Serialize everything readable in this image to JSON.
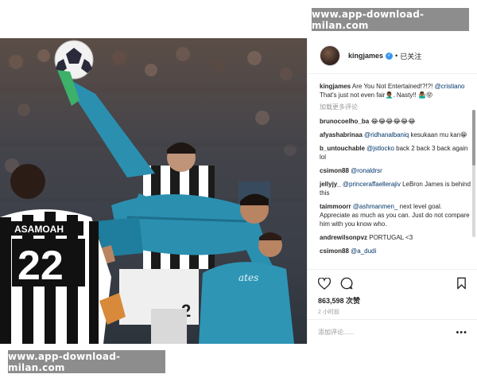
{
  "watermark": {
    "text": "www.app-download-milan.com"
  },
  "post": {
    "username": "kingjames",
    "follow_status": "已关注",
    "separator": "•",
    "verified_icon": "✓"
  },
  "comments": [
    {
      "user": "kingjames",
      "text": "Are You Not Entertained!?!?! ",
      "mention": "@cristiano",
      "text2": " That's just not even fair🤦🏾‍♂️. Nasty!! 🤷🏾‍♂️😝"
    },
    {
      "load_more": "加载更多评论"
    },
    {
      "user": "brunocoelho_ba",
      "text": "😂😂😂😂😂😂"
    },
    {
      "user": "afyashabrinaa",
      "mention": "@ridhanalbaniq",
      "text2": " kesukaan mu kan😁"
    },
    {
      "user": "b_untouchable",
      "mention": "@jstlocko",
      "text2": " back 2 back 3 back again lol"
    },
    {
      "user": "csimon88",
      "mention": "@ronaldrsr"
    },
    {
      "user": "jellyjy_",
      "mention": "@princeraffaellerajiv",
      "text2": " LeBron James is behind this"
    },
    {
      "user": "taimmoorr",
      "mention": "@ashmanmen_",
      "text2": " next level goal. Appreciate as much as you can. Just do not compare him with you know who."
    },
    {
      "user": "andrewilsonpvz",
      "text": "PORTUGAL <3"
    },
    {
      "user": "csimon88",
      "mention": "@a_dudi"
    }
  ],
  "actions": {
    "likes": "863,598 次赞",
    "time": "2 小时前",
    "comment_placeholder": "添加评论......",
    "more": "•••"
  },
  "icons": {
    "like": "heart-icon",
    "comment": "comment-icon",
    "save": "bookmark-icon",
    "more": "more-options-icon"
  },
  "photo": {
    "player_back_name": "ASAMOAH",
    "player_back_number": "22",
    "jersey_number_partial": "2",
    "sponsor": "Fly Emirates",
    "sponsor_partial": "ates"
  },
  "colors": {
    "accent_blue": "#3897f0",
    "mention": "#003569",
    "real_madrid_kit": "#2b8fb0",
    "juventus_kit": "#ffffff"
  }
}
